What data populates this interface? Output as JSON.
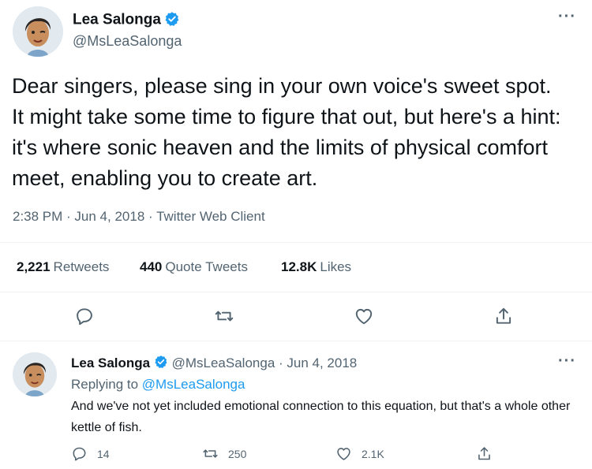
{
  "main_tweet": {
    "display_name": "Lea Salonga",
    "handle": "@MsLeaSalonga",
    "more_label": "···",
    "text": "Dear singers, please sing in your own voice's sweet spot. It might take some time to figure that out, but here's a hint: it's where sonic heaven and the limits of physical comfort meet, enabling you to create art.",
    "timestamp": "2:38 PM · Jun 4, 2018 · Twitter Web Client",
    "stats": {
      "retweets_count": "2,221",
      "retweets_label": "Retweets",
      "quotes_count": "440",
      "quotes_label": "Quote Tweets",
      "likes_count": "12.8K",
      "likes_label": "Likes"
    },
    "actions": [
      "reply-icon",
      "retweet-icon",
      "like-icon",
      "share-icon"
    ]
  },
  "reply_tweet": {
    "display_name": "Lea Salonga",
    "handle_date": "@MsLeaSalonga · Jun 4, 2018",
    "more_label": "···",
    "replying_prefix": "Replying to",
    "replying_to": "@MsLeaSalonga",
    "text": "And we've not yet included emotional connection to this equation, but that's a whole other kettle of fish.",
    "counts": {
      "replies": "14",
      "retweets": "250",
      "likes": "2.1K"
    }
  },
  "colors": {
    "text": "#0f1419",
    "secondary": "#536471",
    "verified": "#1d9bf0",
    "divider": "#eff3f4"
  }
}
